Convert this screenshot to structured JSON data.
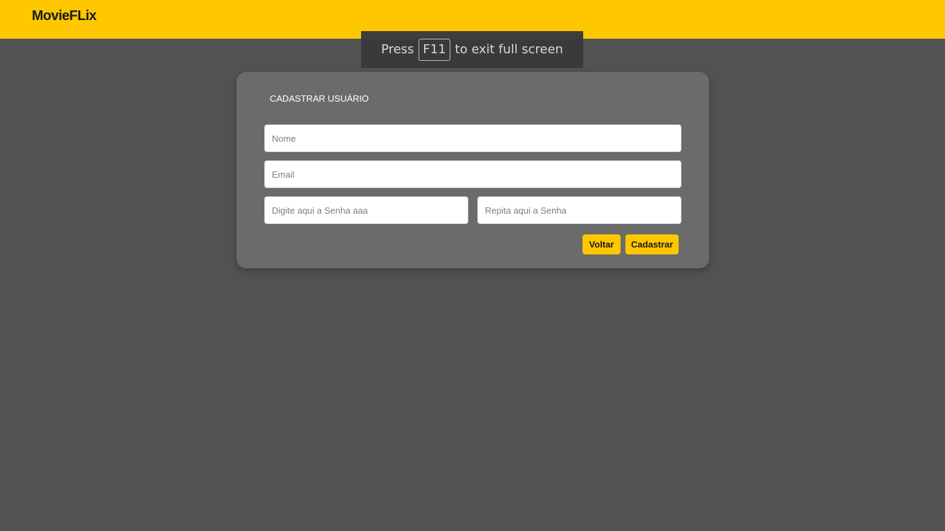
{
  "header": {
    "brand": "MovieFLix"
  },
  "fullscreen_notice": {
    "prefix": "Press",
    "key": "F11",
    "suffix": "to exit full screen"
  },
  "form": {
    "title": "CADASTRAR USUÁRIO",
    "nome_placeholder": "Nome",
    "email_placeholder": "Email",
    "senha_placeholder": "Digite aqui a Senha aaa",
    "repita_placeholder": "Repita aqui a Senha",
    "voltar_label": "Voltar",
    "cadastrar_label": "Cadastrar"
  },
  "colors": {
    "accent": "#ffc700",
    "background": "#525252",
    "card": "#6b6b6b"
  }
}
